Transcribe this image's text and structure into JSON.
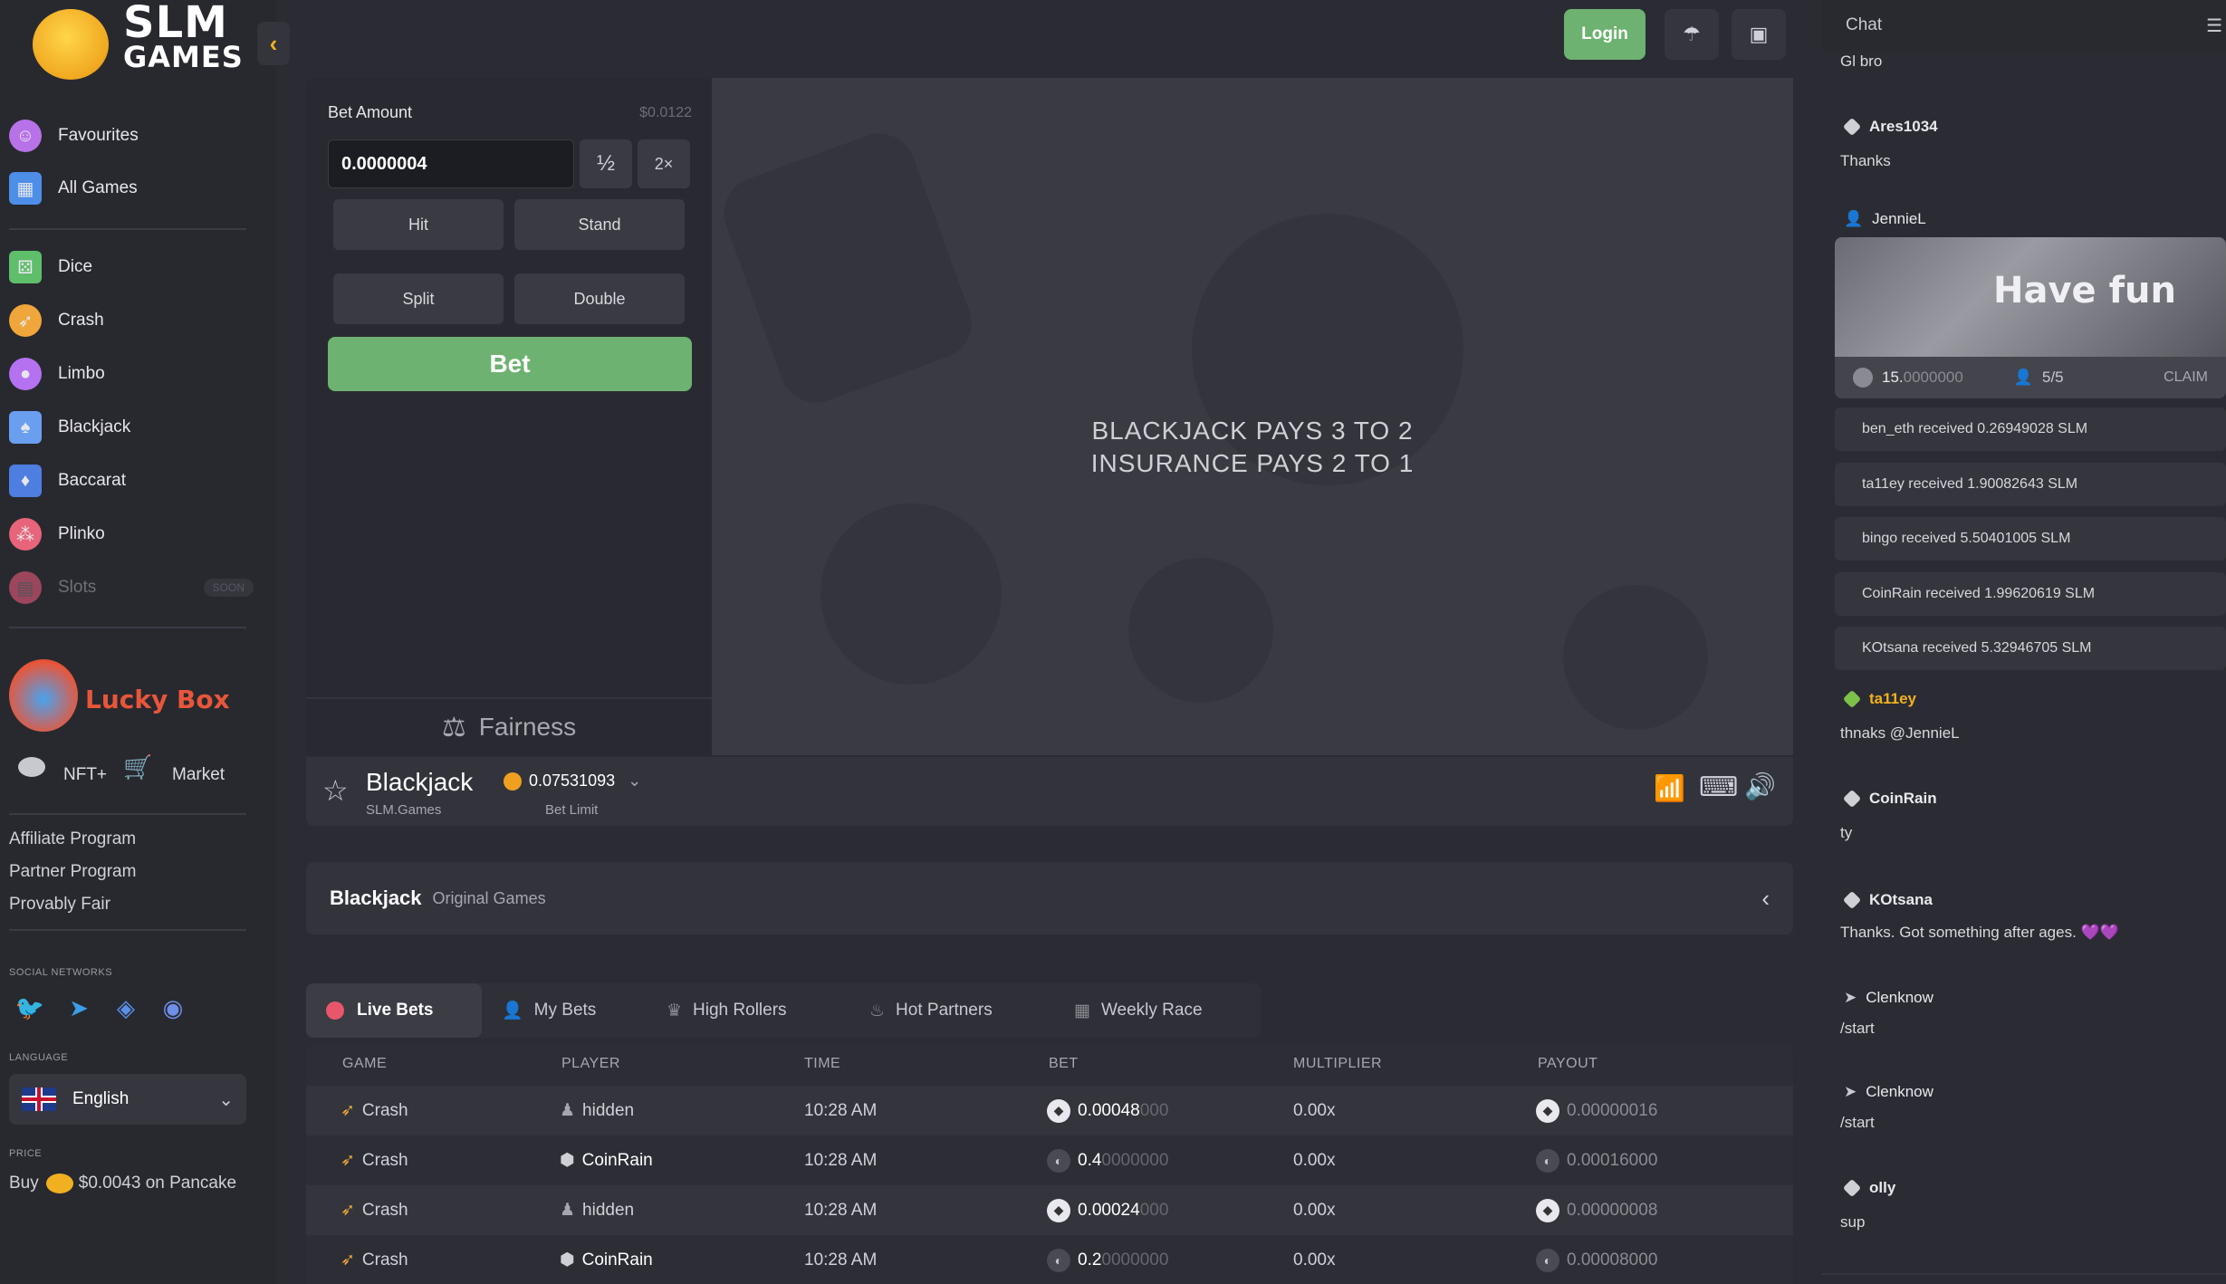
{
  "brand": {
    "line1": "SLM",
    "line2": "GAMES"
  },
  "sidebar": {
    "top_items": [
      {
        "label": "Favourites",
        "icon": "smile-icon",
        "color": "#b872e8"
      },
      {
        "label": "All Games",
        "icon": "grid-icon",
        "color": "#4d8ee8"
      }
    ],
    "games": [
      {
        "label": "Dice",
        "icon": "dice-icon",
        "color": "#5fbe6a"
      },
      {
        "label": "Crash",
        "icon": "rocket-icon",
        "color": "#f0a63a"
      },
      {
        "label": "Limbo",
        "icon": "balloon-icon",
        "color": "#b572f0"
      },
      {
        "label": "Blackjack",
        "icon": "cards-icon",
        "color": "#6a9ff0"
      },
      {
        "label": "Baccarat",
        "icon": "cards-icon",
        "color": "#4d7ee0"
      },
      {
        "label": "Plinko",
        "icon": "balls-icon",
        "color": "#e8647a"
      },
      {
        "label": "Slots",
        "icon": "slot-icon",
        "color": "#e85a7a",
        "badge": "SOON"
      }
    ],
    "lucky_box": "Lucky Box",
    "nft": "NFT+",
    "market": "Market",
    "links": [
      "Affiliate Program",
      "Partner Program",
      "Provably Fair"
    ],
    "social_heading": "SOCIAL NETWORKS",
    "language_heading": "LANGUAGE",
    "language": "English",
    "price_heading": "PRICE",
    "price_prefix": "Buy",
    "price_value": "$0.0043 on Pancake"
  },
  "header": {
    "login": "Login"
  },
  "bet_panel": {
    "label": "Bet Amount",
    "usd": "$0.0122",
    "amount": "0.0000004",
    "half": "½",
    "double_amt": "2×",
    "hit": "Hit",
    "stand": "Stand",
    "split": "Split",
    "double": "Double",
    "bet": "Bet",
    "fairness": "Fairness"
  },
  "table": {
    "line1": "BLACKJACK PAYS 3 TO 2",
    "line2": "INSURANCE PAYS 2 TO 1"
  },
  "game_info": {
    "title": "Blackjack",
    "subtitle": "SLM.Games",
    "limit_value": "0.07531093",
    "limit_label": "Bet Limit"
  },
  "section": {
    "title": "Blackjack",
    "subtitle": "Original Games"
  },
  "tabs": [
    "Live Bets",
    "My Bets",
    "High Rollers",
    "Hot Partners",
    "Weekly Race"
  ],
  "bets": {
    "columns": [
      "GAME",
      "PLAYER",
      "TIME",
      "BET",
      "MULTIPLIER",
      "PAYOUT"
    ],
    "rows": [
      {
        "game": "Crash",
        "player": "hidden",
        "time": "10:28 AM",
        "bet_main": "0.00048",
        "bet_tail": "000",
        "mult": "0.00x",
        "payout": "0.00000016",
        "coin": "eth"
      },
      {
        "game": "Crash",
        "player": "CoinRain",
        "time": "10:28 AM",
        "bet_main": "0.4",
        "bet_tail": "0000000",
        "mult": "0.00x",
        "payout": "0.00016000",
        "coin": "slm"
      },
      {
        "game": "Crash",
        "player": "hidden",
        "time": "10:28 AM",
        "bet_main": "0.00024",
        "bet_tail": "000",
        "mult": "0.00x",
        "payout": "0.00000008",
        "coin": "eth"
      },
      {
        "game": "Crash",
        "player": "CoinRain",
        "time": "10:28 AM",
        "bet_main": "0.2",
        "bet_tail": "0000000",
        "mult": "0.00x",
        "payout": "0.00008000",
        "coin": "slm"
      }
    ]
  },
  "chat": {
    "title": "Chat",
    "first_msg": "Gl bro",
    "ares": {
      "name": "Ares1034",
      "msg": "Thanks"
    },
    "jennie": {
      "name": "JennieL"
    },
    "banner": {
      "text": "Have fun",
      "amount_main": "15.",
      "amount_tail": "0000000",
      "count": "5/5",
      "claim": "CLAIM"
    },
    "rains": [
      "ben_eth  received 0.26949028 SLM",
      "ta11ey  received 1.90082643 SLM",
      "bingo  received 5.50401005 SLM",
      "CoinRain  received 1.99620619 SLM",
      "KOtsana  received 5.32946705 SLM"
    ],
    "messages": [
      {
        "name": "ta11ey",
        "msg": "thnaks @JennieL"
      },
      {
        "name": "CoinRain",
        "msg": "ty"
      },
      {
        "name": "KOtsana",
        "msg": "Thanks. Got something after ages. 💜💜"
      },
      {
        "name": "Clenknow",
        "msg": "/start"
      },
      {
        "name": "Clenknow",
        "msg": "/start"
      },
      {
        "name": "olly",
        "msg": "sup"
      }
    ]
  }
}
